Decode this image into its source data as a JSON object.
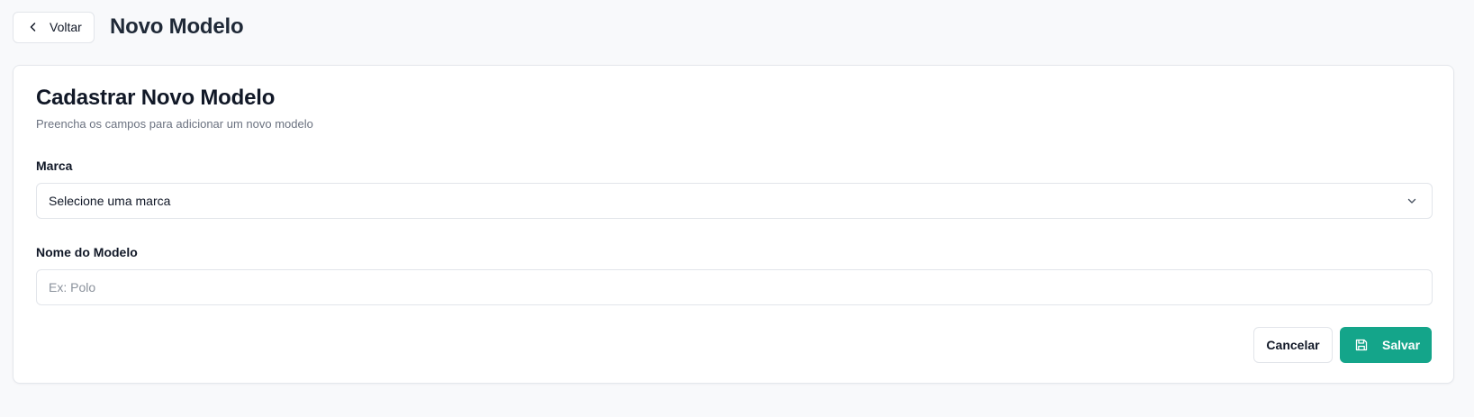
{
  "header": {
    "back_label": "Voltar",
    "title": "Novo Modelo",
    "back_icon": "chevron-left-icon"
  },
  "form": {
    "title": "Cadastrar Novo Modelo",
    "subtitle": "Preencha os campos para adicionar um novo modelo",
    "brand": {
      "label": "Marca",
      "selected_value": "Selecione uma marca",
      "icon": "chevron-down-icon"
    },
    "model_name": {
      "label": "Nome do Modelo",
      "value": "",
      "placeholder": "Ex: Polo"
    },
    "actions": {
      "cancel_label": "Cancelar",
      "save_label": "Salvar",
      "save_icon": "save-icon"
    }
  },
  "colors": {
    "primary": "#14a58a",
    "background": "#f8f9fb",
    "border": "#e2e5ea",
    "muted_text": "#6b7280"
  }
}
